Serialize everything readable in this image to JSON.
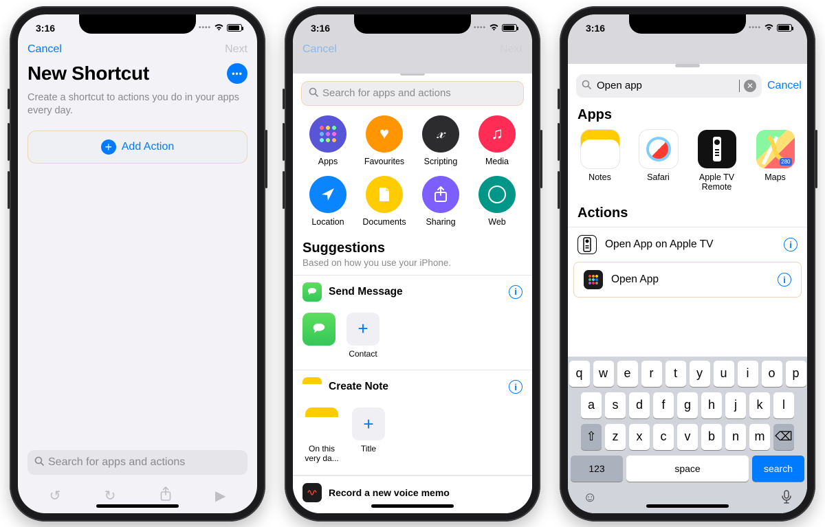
{
  "status": {
    "time": "3:16"
  },
  "p1": {
    "nav": {
      "cancel": "Cancel",
      "next": "Next"
    },
    "title": "New Shortcut",
    "subtitle": "Create a shortcut to actions you do in your apps every day.",
    "add_action": "Add Action",
    "search_placeholder": "Search for apps and actions"
  },
  "p2": {
    "nav": {
      "cancel": "Cancel",
      "next": "Next"
    },
    "search_placeholder": "Search for apps and actions",
    "categories": [
      {
        "label": "Apps"
      },
      {
        "label": "Favourites"
      },
      {
        "label": "Scripting"
      },
      {
        "label": "Media"
      },
      {
        "label": "Location"
      },
      {
        "label": "Documents"
      },
      {
        "label": "Sharing"
      },
      {
        "label": "Web"
      }
    ],
    "suggestions_title": "Suggestions",
    "suggestions_sub": "Based on how you use your iPhone.",
    "sug1": {
      "title": "Send Message",
      "params": [
        {
          "cap": ""
        },
        {
          "cap": "Contact"
        }
      ]
    },
    "sug2": {
      "title": "Create Note",
      "params": [
        {
          "cap": "On this very da..."
        },
        {
          "cap": "Title"
        }
      ]
    },
    "sug3": {
      "title": "Record a new voice memo"
    }
  },
  "p3": {
    "search_value": "Open app",
    "cancel": "Cancel",
    "apps_header": "Apps",
    "apps": [
      {
        "label": "Notes"
      },
      {
        "label": "Safari"
      },
      {
        "label": "Apple TV Remote"
      },
      {
        "label": "Maps"
      }
    ],
    "actions_header": "Actions",
    "actions": [
      {
        "label": "Open App on Apple TV"
      },
      {
        "label": "Open App"
      }
    ],
    "keyboard": {
      "row1": [
        "q",
        "w",
        "e",
        "r",
        "t",
        "y",
        "u",
        "i",
        "o",
        "p"
      ],
      "row2": [
        "a",
        "s",
        "d",
        "f",
        "g",
        "h",
        "j",
        "k",
        "l"
      ],
      "row3": [
        "z",
        "x",
        "c",
        "v",
        "b",
        "n",
        "m"
      ],
      "num": "123",
      "space": "space",
      "search": "search"
    }
  }
}
